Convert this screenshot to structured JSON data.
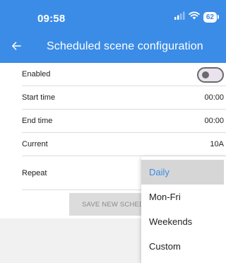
{
  "status_bar": {
    "time": "09:58",
    "battery": "62",
    "icons": [
      "signal-icon",
      "wifi-icon",
      "battery-icon"
    ]
  },
  "app_bar": {
    "title": "Scheduled scene configuration",
    "back_icon": "arrow-left-icon"
  },
  "settings": {
    "enabled": {
      "label": "Enabled",
      "value": false
    },
    "start_time": {
      "label": "Start time",
      "value": "00:00"
    },
    "end_time": {
      "label": "End time",
      "value": "00:00"
    },
    "current": {
      "label": "Current",
      "value": "10A"
    },
    "repeat": {
      "label": "Repeat"
    }
  },
  "save_button": {
    "label": "SAVE NEW SCHED"
  },
  "repeat_dropdown": {
    "options": [
      "Daily",
      "Mon-Fri",
      "Weekends",
      "Custom"
    ],
    "selected": "Daily"
  },
  "colors": {
    "accent": "#3b8ce6",
    "toggle_track": "#eae3ee",
    "toggle_border": "#6a6a6a",
    "selected_bg": "#d6d6d6"
  }
}
